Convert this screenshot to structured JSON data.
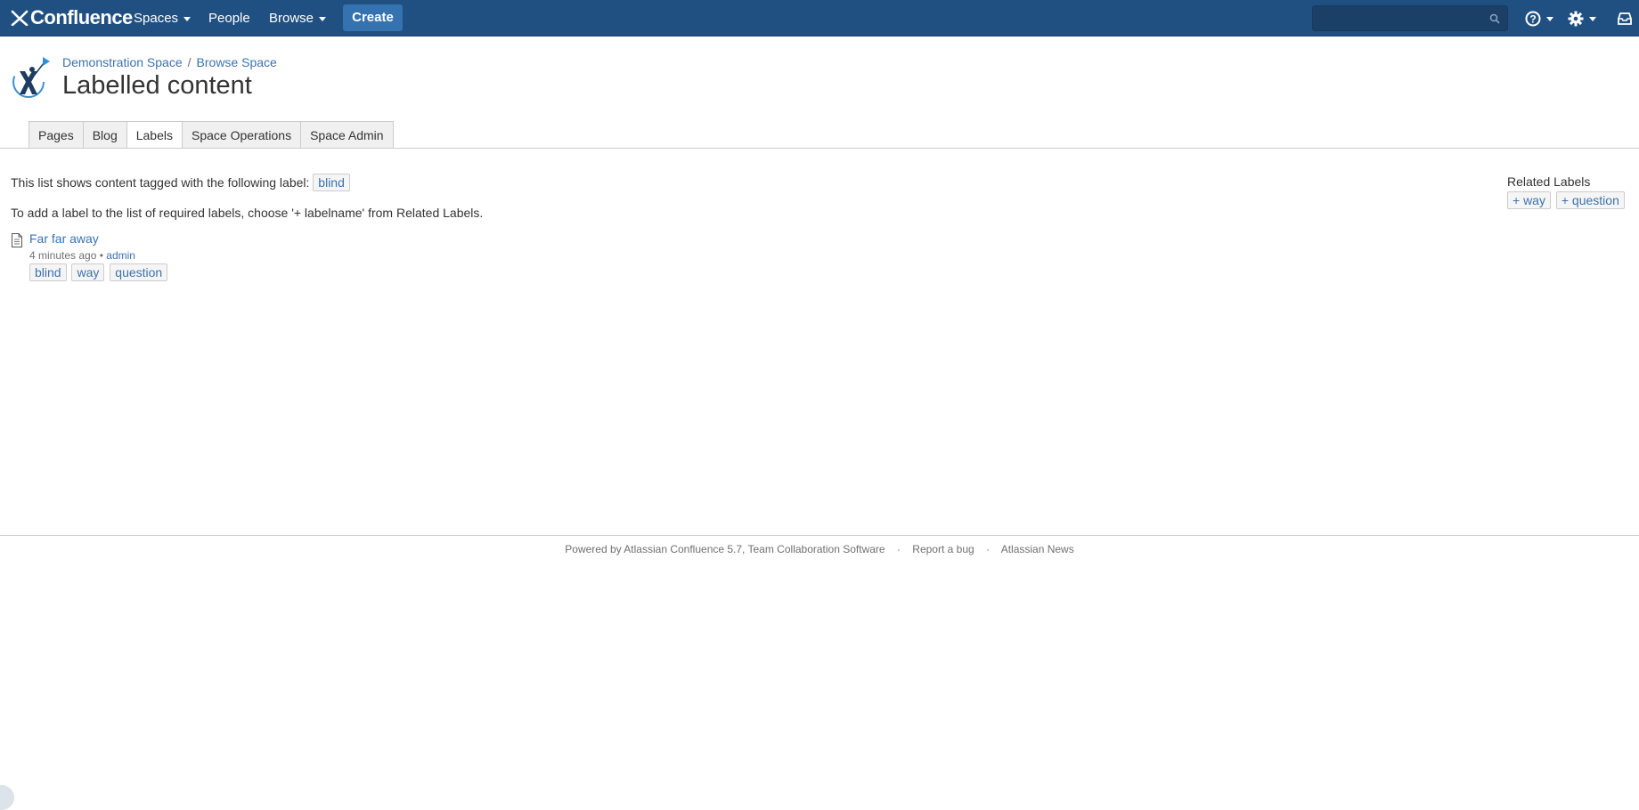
{
  "header": {
    "brand": "Confluence",
    "nav": {
      "spaces": "Spaces",
      "people": "People",
      "browse": "Browse"
    },
    "create_label": "Create",
    "search_placeholder": ""
  },
  "page": {
    "breadcrumb": [
      "Demonstration Space",
      "Browse Space"
    ],
    "breadcrumb_separator": "/",
    "title": "Labelled content"
  },
  "tabs": [
    {
      "label": "Pages",
      "active": false
    },
    {
      "label": "Blog",
      "active": false
    },
    {
      "label": "Labels",
      "active": true
    },
    {
      "label": "Space Operations",
      "active": false
    },
    {
      "label": "Space Admin",
      "active": false
    }
  ],
  "content": {
    "intro_text": "This list shows content tagged with the following label:",
    "intro_label": "blind",
    "hint_text": "To add a label to the list of required labels, choose '+ labelname' from Related Labels.",
    "results": [
      {
        "title": "Far far away",
        "time": "4 minutes ago",
        "meta_separator": "•",
        "author": "admin",
        "labels": [
          "blind",
          "way",
          "question"
        ]
      }
    ]
  },
  "related_labels": {
    "heading": "Related Labels",
    "items": [
      "+ way",
      "+ question"
    ]
  },
  "footer": {
    "powered_by": "Powered by Atlassian Confluence 5.7, Team Collaboration Software",
    "report_bug": "Report a bug",
    "news": "Atlassian News",
    "separator": "·"
  },
  "colors": {
    "header_bg": "#205081",
    "create_button": "#3572b0",
    "link": "#3b73af"
  },
  "icons": [
    "confluence-logo-icon",
    "search-icon",
    "help-icon",
    "settings-icon",
    "notifications-icon",
    "space-logo-icon",
    "page-document-icon"
  ]
}
